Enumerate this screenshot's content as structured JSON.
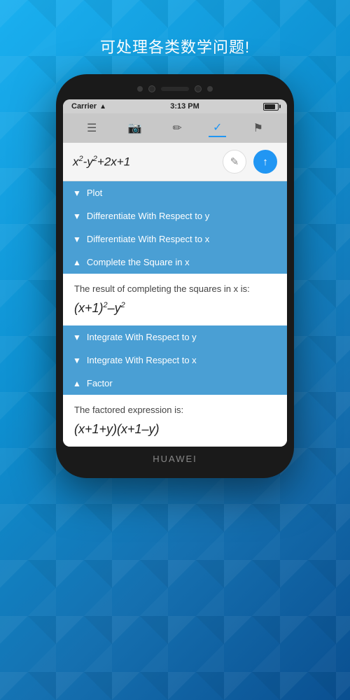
{
  "page": {
    "title": "可处理各类数学问题!"
  },
  "status_bar": {
    "carrier": "Carrier",
    "time": "3:13 PM"
  },
  "toolbar": {
    "camera_icon": "📷",
    "pencil_icon": "✏",
    "check_icon": "✓",
    "flag_icon": "⚑"
  },
  "formula": {
    "display": "x²-y²+2x+1"
  },
  "menu_items": [
    {
      "id": "plot",
      "label": "Plot",
      "chevron": "▼",
      "expanded": false
    },
    {
      "id": "diff-y",
      "label": "Differentiate With Respect to y",
      "chevron": "▼",
      "expanded": false
    },
    {
      "id": "diff-x",
      "label": "Differentiate With Respect to x",
      "chevron": "▼",
      "expanded": false
    },
    {
      "id": "complete-square",
      "label": "Complete the Square in x",
      "chevron": "▲",
      "expanded": true
    },
    {
      "id": "integrate-y",
      "label": "Integrate With Respect to y",
      "chevron": "▼",
      "expanded": false
    },
    {
      "id": "integrate-x",
      "label": "Integrate With Respect to x",
      "chevron": "▼",
      "expanded": false
    },
    {
      "id": "factor",
      "label": "Factor",
      "chevron": "▲",
      "expanded": true
    }
  ],
  "expanded_sections": {
    "complete_square": {
      "description": "The result of completing the squares in x is:",
      "result": "(x+1)²–y²"
    },
    "factor": {
      "description": "The factored expression is:",
      "result": "(x+1+y)(x+1–y)"
    }
  },
  "phone_brand": "HUAWEI"
}
